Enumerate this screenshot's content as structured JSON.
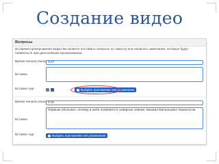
{
  "slide": {
    "title": "Создание видео"
  },
  "panel": {
    "header": "Вопросы",
    "description": "Во время проигрывания видео Вы можете поставить вопросы по смыслу или написать замечания, которые будут появляться при дальнейшем проигрывании."
  },
  "questions": [
    {
      "time_label": "Время начала показа",
      "time_value": "0:27",
      "insert_label": "Вставка",
      "insert_text": "",
      "app_label": "Вставка App",
      "app_button": "Выбрать приложение или упражнение",
      "app_highlighted": true
    },
    {
      "time_label": "Время начала показа",
      "time_value": "0:31",
      "insert_label": "Вставка",
      "insert_text": "Первым объяснил, почему в небе появляется северное сияние, Михаил Васильевич Ломоносов",
      "app_label": "Вставка App",
      "app_button": "Выбрать приложение или упражнение",
      "app_highlighted": false
    }
  ],
  "colors": {
    "title": "#2f5496",
    "button": "#1e5fbf",
    "input_border": "#4a89dc",
    "highlight_ring": "#d9232e"
  }
}
